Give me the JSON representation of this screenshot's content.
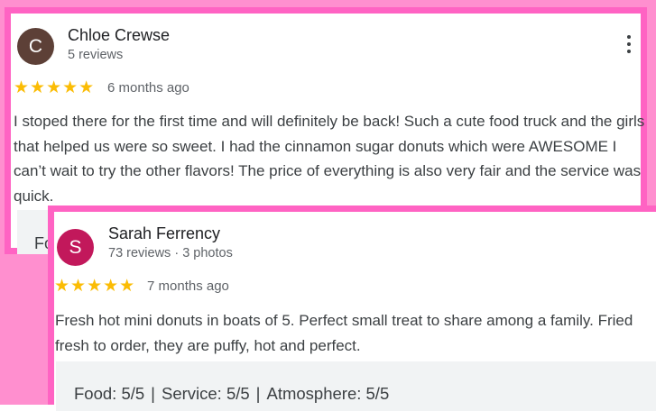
{
  "reviews": [
    {
      "avatar_letter": "C",
      "avatar_color": "#5d4037",
      "name": "Chloe Crewse",
      "meta": "5 reviews",
      "stars": "★★★★★",
      "rating": 5,
      "time_ago": "6 months ago",
      "text": "I stoped there for the first time and will definitely be back! Such a cute food truck and the girls that helped us were so sweet. I had the cinnamon sugar donuts which were AWESOME I can’t wait to try the other flavors! The price of everything is also very fair and the service was quick.",
      "footer_stub": "Fo"
    },
    {
      "avatar_letter": "S",
      "avatar_color": "#c2185b",
      "name": "Sarah Ferrency",
      "meta": "73 reviews · 3 photos",
      "stars": "★★★★★",
      "rating": 5,
      "time_ago": "7 months ago",
      "text": "Fresh hot mini donuts in boats of 5. Perfect small treat to share among a family. Fried fresh to order, they are puffy, hot and perfect.",
      "ratings": {
        "food": "Food: 5/5",
        "service": "Service: 5/5",
        "atmosphere": "Atmosphere: 5/5",
        "separator": "|"
      }
    }
  ],
  "colors": {
    "frame_pink": "#ff63c3",
    "background_pink": "#ff8fcf",
    "star_yellow": "#fbbc04"
  },
  "icons": {
    "more_options": "more-vert-icon"
  }
}
